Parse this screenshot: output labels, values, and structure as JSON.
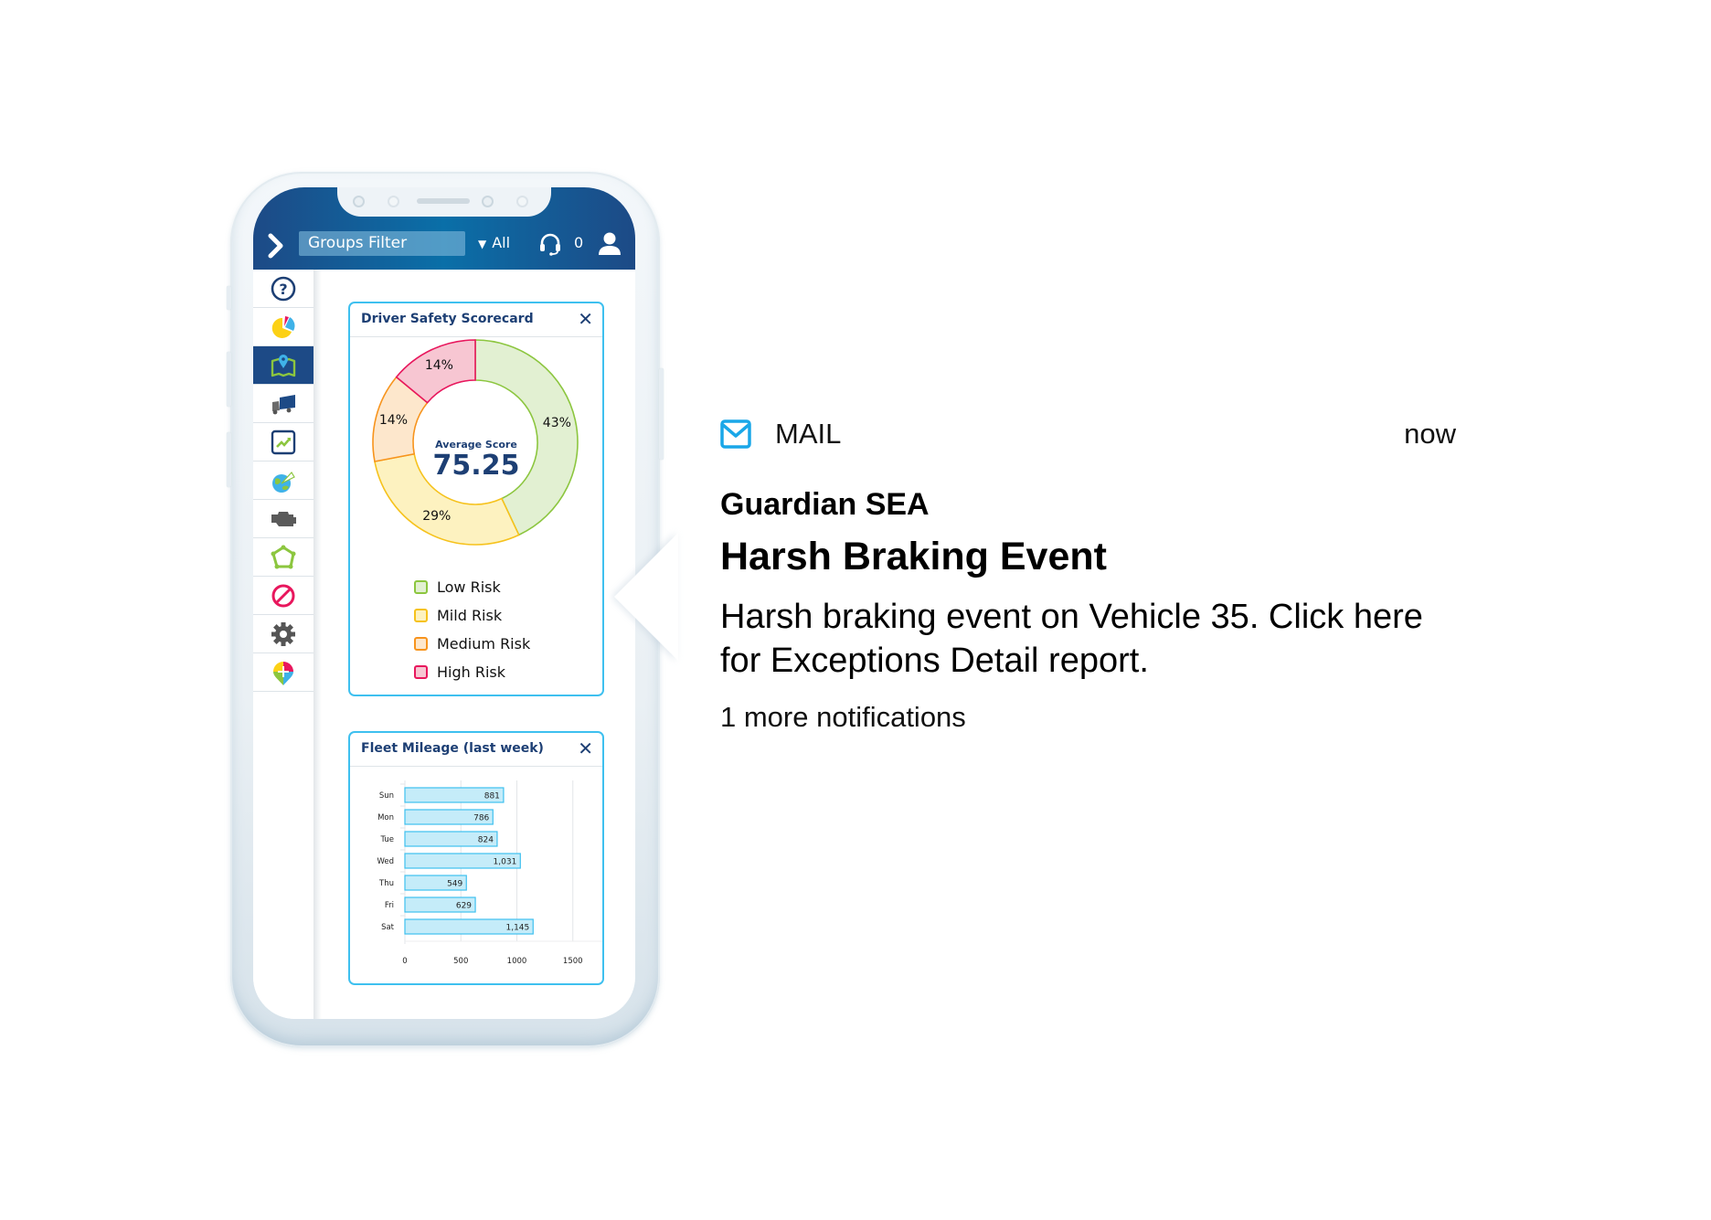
{
  "app_header": {
    "groups_filter_label": "Groups Filter",
    "filter_value": "All",
    "support_count": "0"
  },
  "sidebar": {
    "items": [
      {
        "icon": "help-icon",
        "active": false
      },
      {
        "icon": "pie-chart-icon",
        "active": false
      },
      {
        "icon": "map-pin-icon",
        "active": true
      },
      {
        "icon": "truck-icon",
        "active": false
      },
      {
        "icon": "trend-chart-icon",
        "active": false
      },
      {
        "icon": "globe-signal-icon",
        "active": false
      },
      {
        "icon": "engine-icon",
        "active": false
      },
      {
        "icon": "geofence-icon",
        "active": false
      },
      {
        "icon": "prohibited-icon",
        "active": false
      },
      {
        "icon": "gear-icon",
        "active": false
      },
      {
        "icon": "directions-pin-icon",
        "active": false
      }
    ]
  },
  "scorecard": {
    "title": "Driver Safety Scorecard",
    "close": "✕",
    "center_label": "Average Score",
    "center_value": "75.25"
  },
  "mileage": {
    "title": "Fleet Mileage (last week)",
    "close": "✕"
  },
  "chart_data": [
    {
      "type": "pie",
      "title": "Driver Safety Scorecard",
      "donut": true,
      "center_text": {
        "label": "Average Score",
        "value": 75.25
      },
      "categories": [
        "Low Risk",
        "Mild Risk",
        "Medium Risk",
        "High Risk"
      ],
      "values": [
        43,
        29,
        14,
        14
      ],
      "labels": [
        "43%",
        "29%",
        "14%",
        "14%"
      ],
      "colors": {
        "fill": [
          "#e2f0d2",
          "#fdf2c0",
          "#fde7cc",
          "#f7c6d2"
        ],
        "stroke": [
          "#8cc63f",
          "#f6c21c",
          "#f7941d",
          "#e8175d"
        ]
      },
      "legend": "bottom"
    },
    {
      "type": "bar",
      "orientation": "horizontal",
      "title": "Fleet Mileage (last week)",
      "categories": [
        "Sun",
        "Mon",
        "Tue",
        "Wed",
        "Thu",
        "Fri",
        "Sat"
      ],
      "values": [
        881,
        786,
        824,
        1031,
        549,
        629,
        1145
      ],
      "value_labels": [
        "881",
        "786",
        "824",
        "1,031",
        "549",
        "629",
        "1,145"
      ],
      "xticks": [
        "0",
        "500",
        "1000",
        "1500"
      ],
      "xlim": [
        0,
        2000
      ],
      "grid": true,
      "bar_color": "#c5ecf9",
      "bar_stroke": "#3ec0ef"
    }
  ],
  "notification": {
    "app": "MAIL",
    "time": "now",
    "sender": "Guardian SEA",
    "subject": "Harsh Braking Event",
    "body": "Harsh braking event on Vehicle 35. Click here for Exceptions Detail report.",
    "more": "1 more notifications",
    "accent": "#1aa7e8"
  }
}
